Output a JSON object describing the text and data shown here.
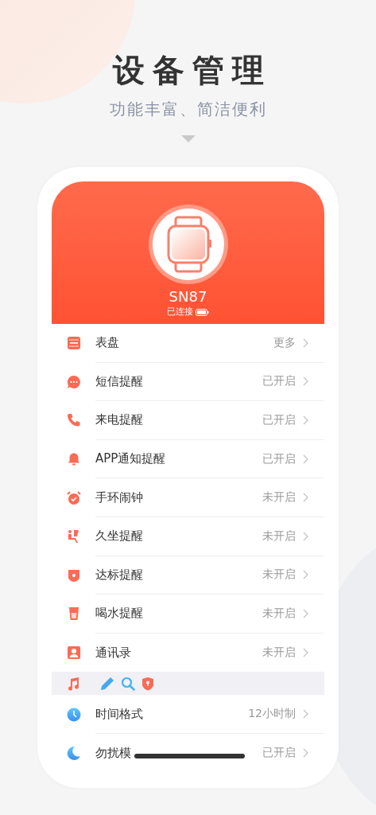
{
  "headline": {
    "title": "设备管理",
    "subtitle": "功能丰富、简洁便利"
  },
  "device": {
    "name": "SN87",
    "status": "已连接"
  },
  "settings": [
    {
      "label": "表盘",
      "value": "更多"
    },
    {
      "label": "短信提醒",
      "value": "已开启"
    },
    {
      "label": "来电提醒",
      "value": "已开启"
    },
    {
      "label": "APP通知提醒",
      "value": "已开启"
    },
    {
      "label": "手环闹钟",
      "value": "未开启"
    },
    {
      "label": "久坐提醒",
      "value": "未开启"
    },
    {
      "label": "达标提醒",
      "value": "未开启"
    },
    {
      "label": "喝水提醒",
      "value": "未开启"
    },
    {
      "label": "通讯录",
      "value": "未开启"
    }
  ],
  "more_settings": [
    {
      "label": "时间格式",
      "value": "12小时制"
    },
    {
      "label": "勿扰模",
      "value": "已开启"
    }
  ]
}
